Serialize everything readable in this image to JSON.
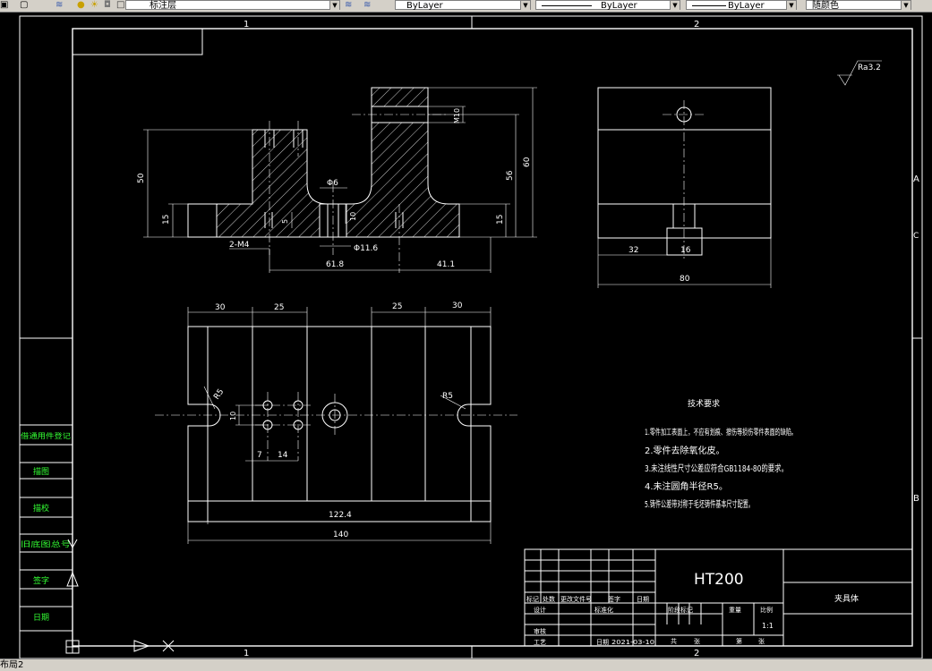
{
  "toolbar": {
    "layer_name": "标注层",
    "color_value": "ByLayer",
    "linetype_value": "ByLayer",
    "lineweight_value": "ByLayer",
    "plotstyle_value": "随颜色"
  },
  "sheet": {
    "zone_top_1": "1",
    "zone_top_2": "2",
    "zone_bottom_1": "1",
    "zone_bottom_2": "2",
    "zone_right_a": "A",
    "zone_right_b": "B",
    "zone_right_c": "C"
  },
  "front_view": {
    "dim_50": "50",
    "dim_15_left": "15",
    "dim_phi6": "Φ6",
    "dim_m10": "M10",
    "dim_56": "56",
    "dim_60": "60",
    "dim_15_right": "15",
    "dim_5": "5",
    "dim_10": "10",
    "dim_2m4": "2-M4",
    "dim_phi11_6": "Φ11.6",
    "dim_61_8": "61.8",
    "dim_41_1": "41.1"
  },
  "side_view": {
    "roughness": "Ra3.2",
    "dim_32": "32",
    "dim_16": "16",
    "dim_80": "80"
  },
  "top_view": {
    "dim_30_left": "30",
    "dim_25_left": "25",
    "dim_25_right": "25",
    "dim_30_right": "30",
    "dim_r5_left": "R5",
    "dim_r5_right": "R5",
    "dim_10": "10",
    "dim_7": "7",
    "dim_14": "14",
    "dim_122_4": "122.4",
    "dim_140": "140"
  },
  "notes": {
    "title": "技术要求",
    "items": [
      "1.零件加工表面上，不应有划痕、擦伤等损伤零件表面的缺陷。",
      "2.零件去除氧化皮。",
      "3.未注线性尺寸公差应符合GB1184-80的要求。",
      "4.未注圆角半径R5。",
      "5.铸件公差带对称于毛坯铸件基本尺寸配置。"
    ]
  },
  "left_strip": {
    "labels": [
      "借通用件登记",
      "描图",
      "描校",
      "旧底图总号",
      "签字",
      "日期"
    ]
  },
  "title_block": {
    "material": "HT200",
    "part_name": "夹具体",
    "col_mark": "标记",
    "col_count": "处数",
    "col_file": "更改文件号",
    "col_sign": "签字",
    "col_date": "日期",
    "design": "设计",
    "standardization": "标准化",
    "review": "审核",
    "process": "工艺",
    "approve_date": "日期",
    "date_value": "2021-03-10",
    "stage_mark": "阶段标记",
    "weight": "重量",
    "ratio_label": "比例",
    "ratio_value": "1:1",
    "sheets_total": "共",
    "sheet_unit_1": "张",
    "sheet_no": "第",
    "sheet_unit_2": "张"
  },
  "statusbar": {
    "layout_tab": "布局2"
  }
}
